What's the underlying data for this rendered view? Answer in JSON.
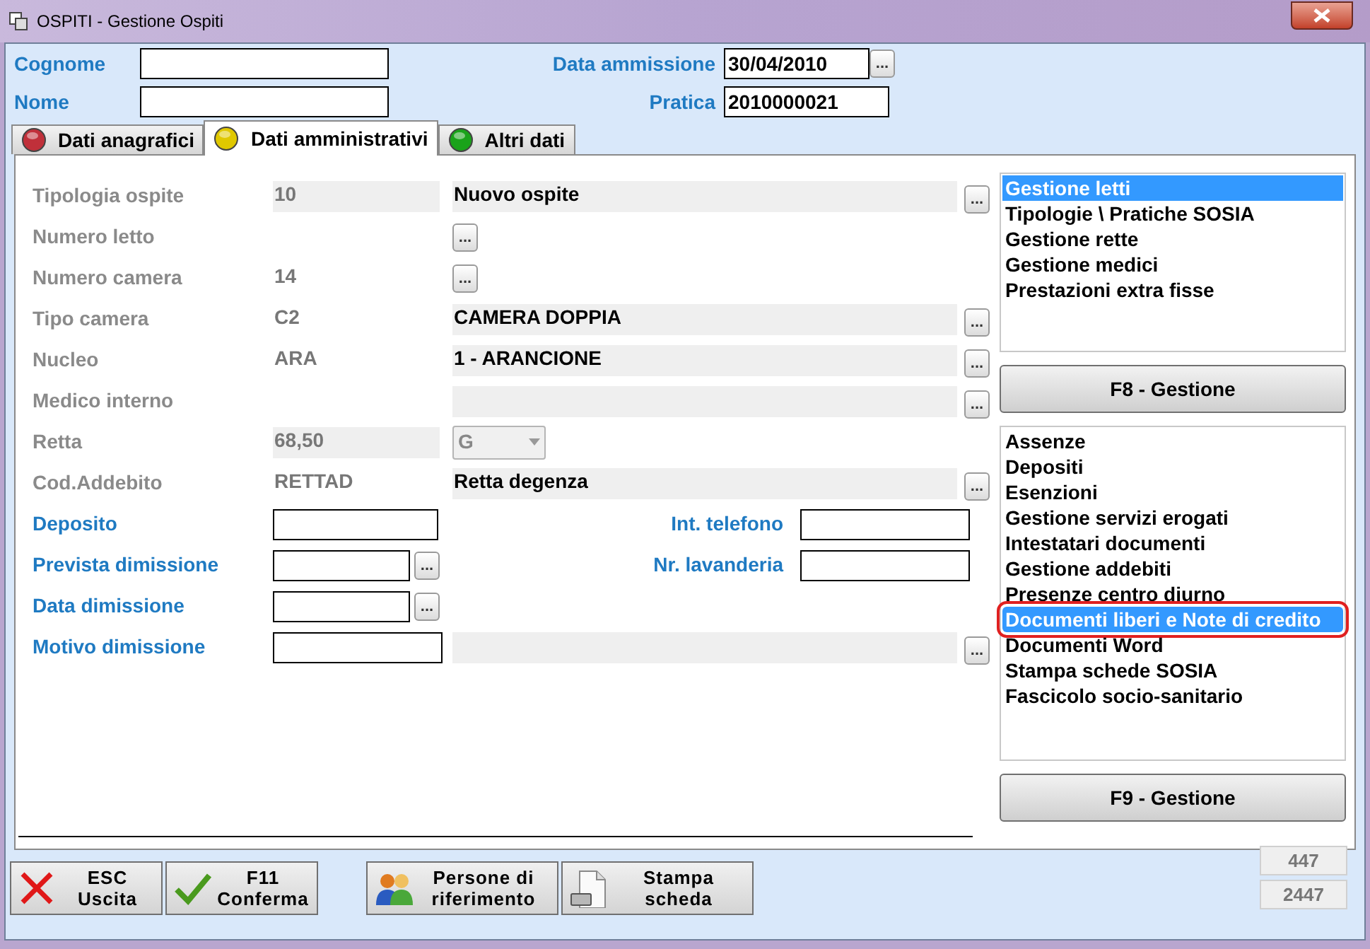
{
  "window": {
    "title": "OSPITI - Gestione Ospiti"
  },
  "header": {
    "cognome": {
      "label": "Cognome"
    },
    "nome": {
      "label": "Nome"
    },
    "data_ammissione": {
      "label": "Data ammissione",
      "value": "30/04/2010",
      "button": "..."
    },
    "pratica": {
      "label": "Pratica",
      "value": "2010000021"
    }
  },
  "tabs": [
    {
      "label": "Dati anagrafici",
      "color": "#c0303a",
      "selected": false
    },
    {
      "label": "Dati amministrativi",
      "color": "#e0c800",
      "selected": true
    },
    {
      "label": "Altri dati",
      "color": "#1aa31a",
      "selected": false
    }
  ],
  "fields": [
    {
      "kind": "lookup",
      "label": "Tipologia ospite",
      "disabled": true,
      "code": "10",
      "code_shaded": true,
      "description": "Nuovo ospite",
      "button": "..."
    },
    {
      "kind": "inline",
      "label": "Numero letto",
      "disabled": true,
      "button": "..."
    },
    {
      "kind": "inline",
      "label": "Numero camera",
      "disabled": true,
      "code": "14",
      "button": "..."
    },
    {
      "kind": "lookup",
      "label": "Tipo camera",
      "disabled": true,
      "code": "C2",
      "code_shaded": false,
      "description": "CAMERA DOPPIA",
      "button": "..."
    },
    {
      "kind": "lookup",
      "label": "Nucleo",
      "disabled": true,
      "code": "ARA",
      "code_shaded": false,
      "description": "1 - ARANCIONE",
      "button": "..."
    },
    {
      "kind": "lookup",
      "label": "Medico interno",
      "disabled": true,
      "button": "..."
    },
    {
      "kind": "select",
      "label": "Retta",
      "disabled": true,
      "code": "68,50",
      "code_shaded": true,
      "select": "G"
    },
    {
      "kind": "lookup",
      "label": "Cod.Addebito",
      "disabled": true,
      "code": "RETTAD",
      "code_shaded": false,
      "description": "Retta degenza",
      "button": "..."
    },
    {
      "kind": "entry",
      "label": "Deposito",
      "disabled": false,
      "side_label": "Int. telefono"
    },
    {
      "kind": "entry",
      "label": "Prevista dimissione",
      "disabled": false,
      "button": "...",
      "side_label": "Nr. lavanderia"
    },
    {
      "kind": "entry",
      "label": "Data dimissione",
      "disabled": false,
      "button": "..."
    },
    {
      "kind": "entry_lookup",
      "label": "Motivo dimissione",
      "disabled": false,
      "button": "..."
    }
  ],
  "list_1": {
    "items": [
      {
        "label": "Gestione letti",
        "selected": true
      },
      {
        "label": "Tipologie \\ Pratiche SOSIA",
        "selected": false
      },
      {
        "label": "Gestione rette",
        "selected": false
      },
      {
        "label": "Gestione medici",
        "selected": false
      },
      {
        "label": "Prestazioni extra fisse",
        "selected": false
      }
    ],
    "button": "F8 - Gestione"
  },
  "list_2": {
    "items": [
      {
        "label": "Assenze",
        "selected": false,
        "circled": false
      },
      {
        "label": "Depositi",
        "selected": false,
        "circled": false
      },
      {
        "label": "Esenzioni",
        "selected": false,
        "circled": false
      },
      {
        "label": "Gestione servizi erogati",
        "selected": false,
        "circled": false
      },
      {
        "label": "Intestatari documenti",
        "selected": false,
        "circled": false
      },
      {
        "label": "Gestione addebiti",
        "selected": false,
        "circled": false
      },
      {
        "label": "Presenze centro diurno",
        "selected": false,
        "circled": false
      },
      {
        "label": "Documenti liberi e Note di credito",
        "selected": true,
        "circled": true
      },
      {
        "label": "Documenti Word",
        "selected": false,
        "circled": false
      },
      {
        "label": "Stampa schede SOSIA",
        "selected": false,
        "circled": false
      },
      {
        "label": "Fascicolo socio-sanitario",
        "selected": false,
        "circled": false
      }
    ],
    "button": "F9 - Gestione"
  },
  "toolbar": [
    {
      "kind": "exit",
      "lines": [
        "ESC",
        "Uscita"
      ]
    },
    {
      "kind": "confirm",
      "lines": [
        "F11",
        "Conferma"
      ]
    },
    {
      "kind": "people",
      "lines": [
        "Persone di",
        "riferimento"
      ]
    },
    {
      "kind": "print",
      "lines": [
        "Stampa",
        "scheda"
      ]
    }
  ],
  "counters": [
    "447",
    "2447"
  ]
}
